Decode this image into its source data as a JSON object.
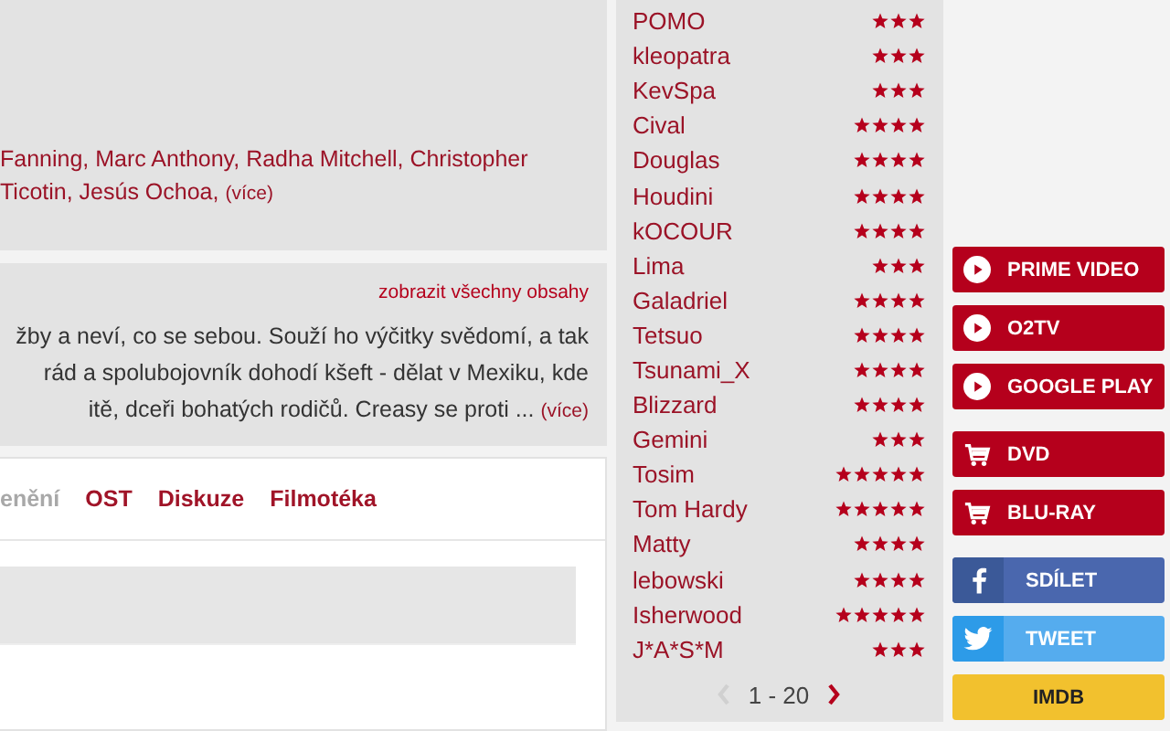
{
  "cast": {
    "lines": [
      "Fanning, Marc Anthony, Radha Mitchell, Christopher",
      "Ticotin, Jesús Ochoa,"
    ],
    "more": "(více)"
  },
  "plot": {
    "all_link": "zobrazit všechny obsahy",
    "lines": [
      "žby a neví, co se sebou.  Souží ho výčitky svědomí, a tak",
      "rád a spolubojovník dohodí kšeft - dělat v Mexiku, kde",
      "itě, dceři bohatých rodičů. Creasy se proti  ..."
    ],
    "more": "(více)"
  },
  "tabs": [
    {
      "label": "enění",
      "disabled": true
    },
    {
      "label": "OST",
      "disabled": false
    },
    {
      "label": "Diskuze",
      "disabled": false
    },
    {
      "label": "Filmotéka",
      "disabled": false
    }
  ],
  "ratings": [
    {
      "user": "POMO",
      "stars": 3
    },
    {
      "user": "kleopatra",
      "stars": 3
    },
    {
      "user": "KevSpa",
      "stars": 3
    },
    {
      "user": "Cival",
      "stars": 4
    },
    {
      "user": "Douglas",
      "stars": 4
    },
    {
      "user": "Houdini",
      "stars": 4
    },
    {
      "user": "kOCOUR",
      "stars": 4
    },
    {
      "user": "Lima",
      "stars": 3
    },
    {
      "user": "Galadriel",
      "stars": 4
    },
    {
      "user": "Tetsuo",
      "stars": 4
    },
    {
      "user": "Tsunami_X",
      "stars": 4
    },
    {
      "user": "Blizzard",
      "stars": 4
    },
    {
      "user": "Gemini",
      "stars": 3
    },
    {
      "user": "Tosim",
      "stars": 5
    },
    {
      "user": "Tom Hardy",
      "stars": 5
    },
    {
      "user": "Matty",
      "stars": 4
    },
    {
      "user": "lebowski",
      "stars": 4
    },
    {
      "user": "Isherwood",
      "stars": 5
    },
    {
      "user": "J*A*S*M",
      "stars": 3
    }
  ],
  "pagination": {
    "range": "1 - 20",
    "prev_disabled": true,
    "next_disabled": false
  },
  "button_groups": [
    [
      {
        "kind": "play",
        "label": "PRIME VIDEO"
      },
      {
        "kind": "play",
        "label": "O2TV"
      },
      {
        "kind": "play",
        "label": "GOOGLE PLAY"
      }
    ],
    [
      {
        "kind": "cart",
        "label": "DVD"
      },
      {
        "kind": "cart",
        "label": "BLU-RAY"
      }
    ],
    [
      {
        "kind": "facebook",
        "label": "SDÍLET"
      },
      {
        "kind": "twitter",
        "label": "TWEET"
      },
      {
        "kind": "imdb",
        "label": "IMDB"
      }
    ]
  ]
}
